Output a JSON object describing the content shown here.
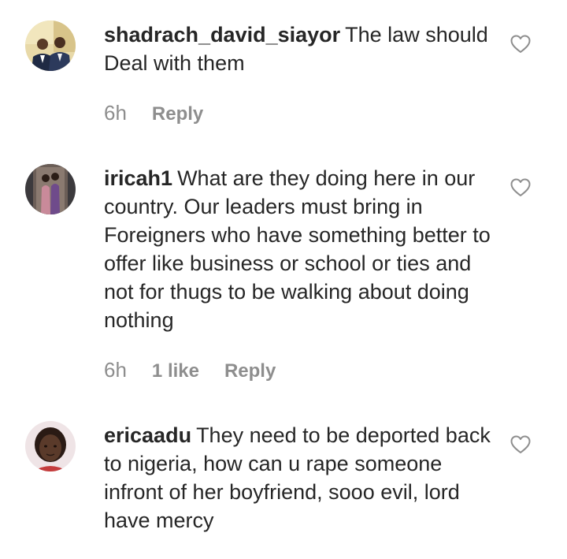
{
  "comments": [
    {
      "username": "shadrach_david_siayor",
      "text": "The law should Deal with them",
      "time": "6h",
      "likes": "",
      "reply_label": "Reply",
      "avatar": "avatar-two-men-suits"
    },
    {
      "username": "iricah1",
      "text": "What are they doing here in our country. Our leaders must bring in Foreigners who have something better to offer like business or school or ties and not for thugs to be walking about doing nothing",
      "time": "6h",
      "likes": "1 like",
      "reply_label": "Reply",
      "avatar": "avatar-two-women"
    },
    {
      "username": "ericaadu",
      "text": "They need to be deported back to nigeria, how can u rape someone infront of her boyfriend, sooo evil, lord have mercy",
      "time": "",
      "likes": "",
      "reply_label": "",
      "avatar": "avatar-woman-portrait"
    }
  ],
  "icons": {
    "like": "heart-outline-icon"
  },
  "colors": {
    "text": "#262626",
    "meta": "#8e8e8e",
    "background": "#ffffff"
  }
}
